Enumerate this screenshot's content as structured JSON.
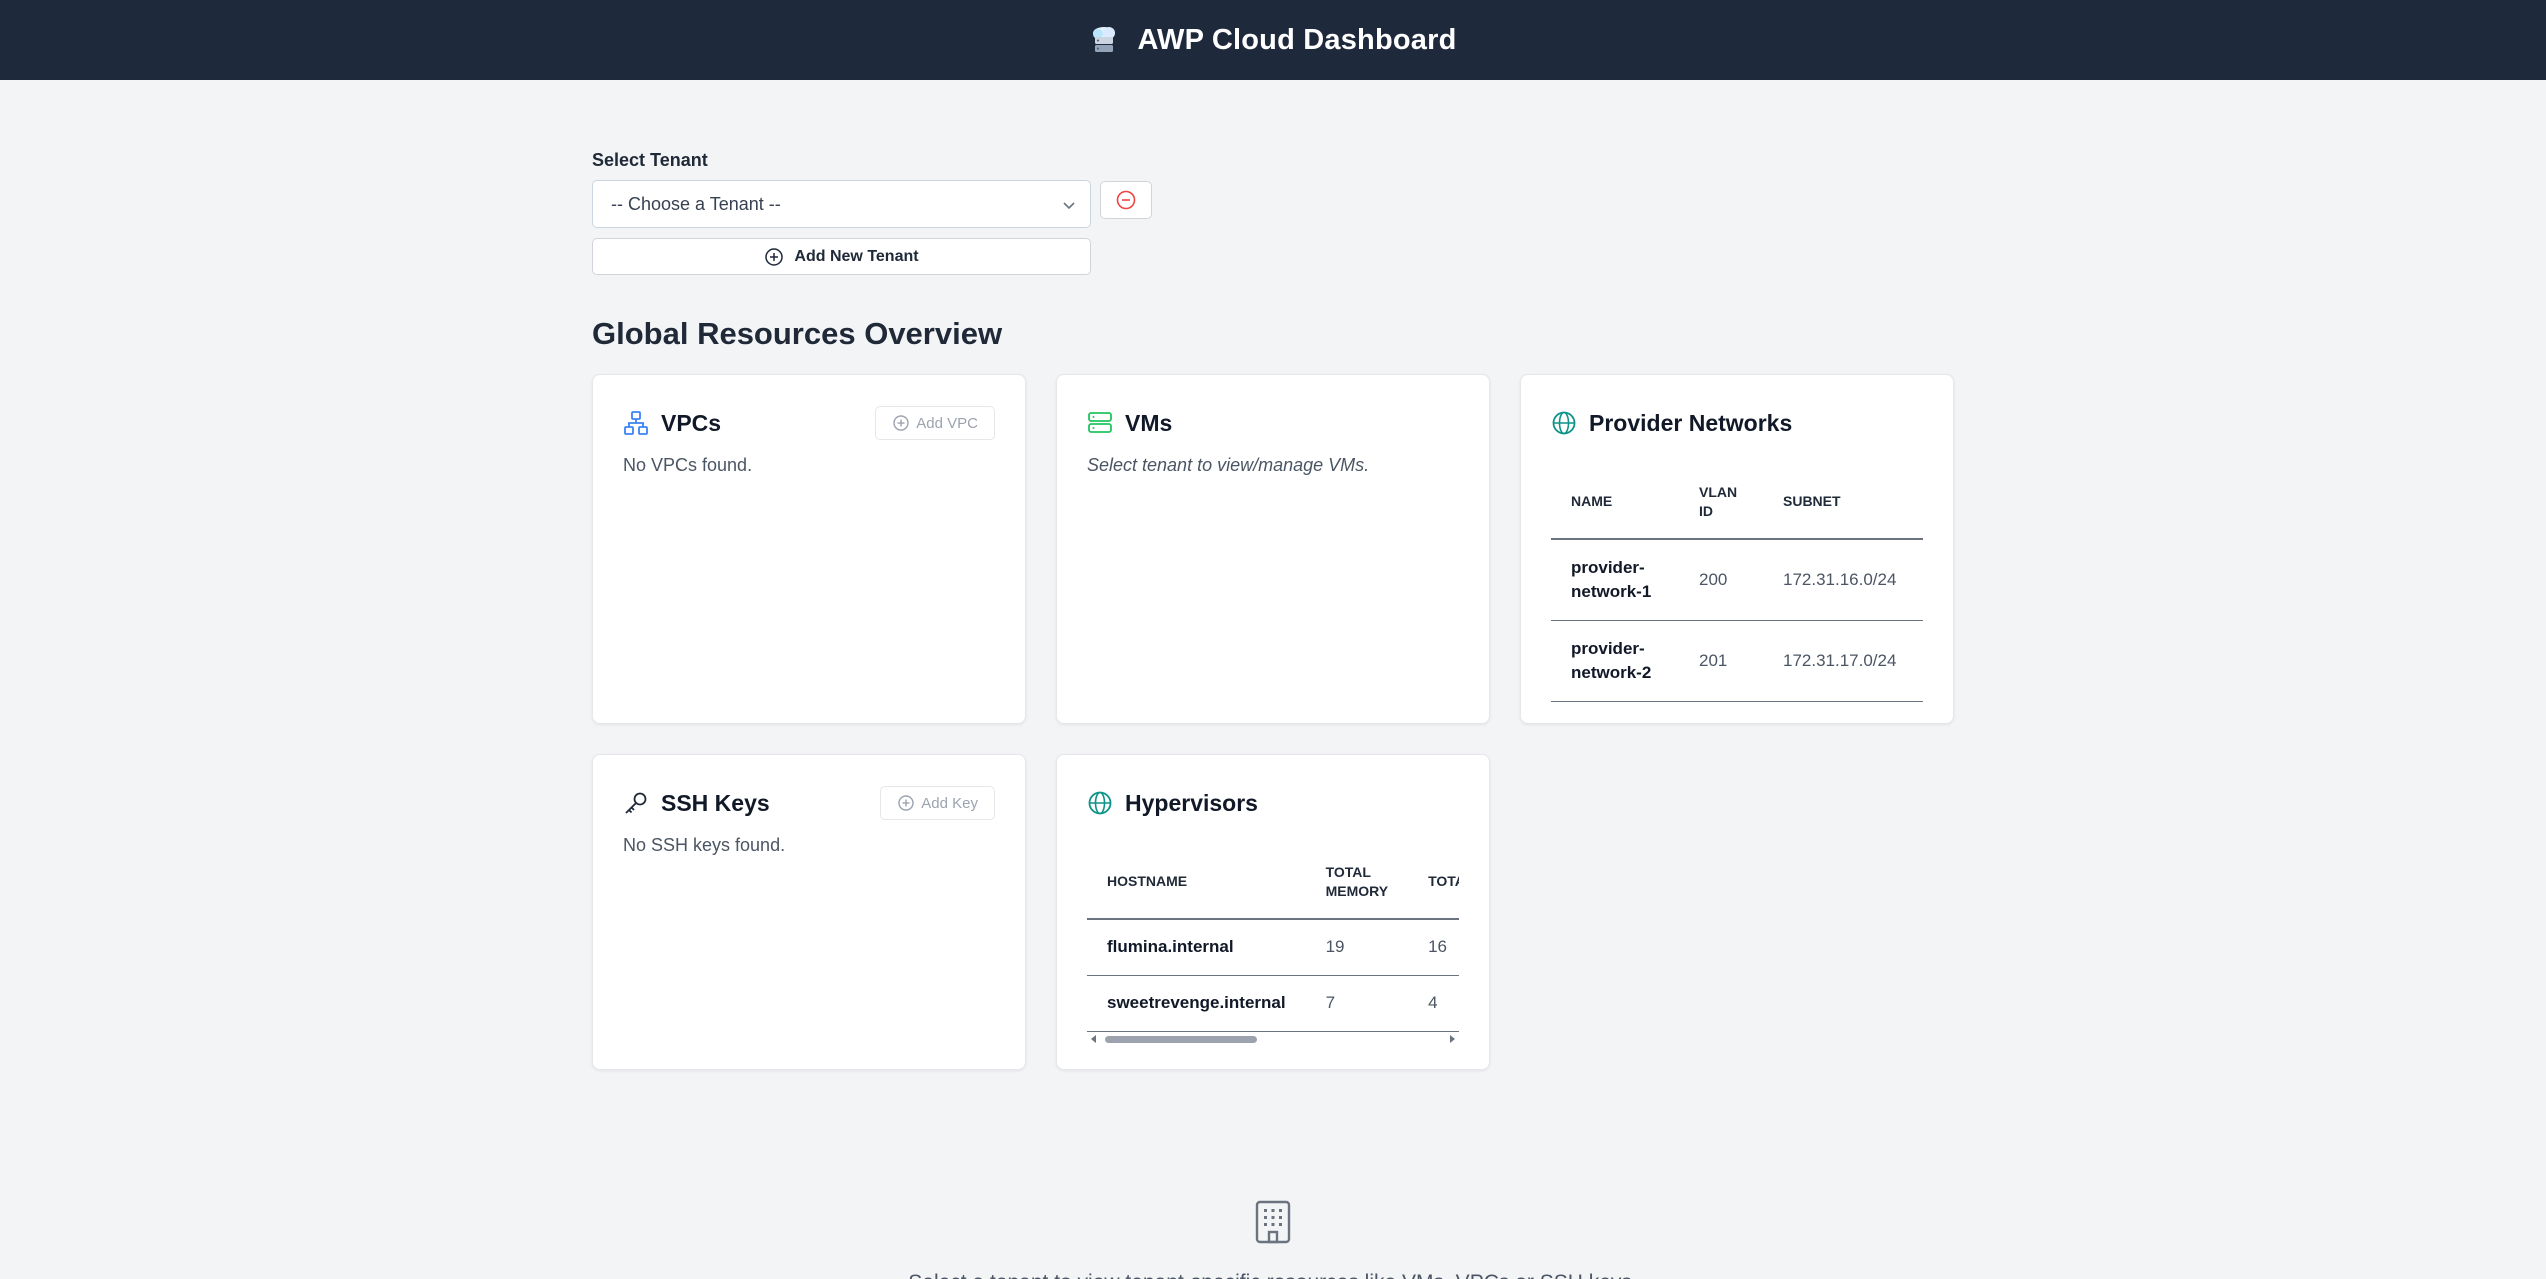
{
  "header": {
    "title": "AWP Cloud Dashboard",
    "logo_icon": "cloud-logo-icon"
  },
  "tenant": {
    "label": "Select Tenant",
    "selected": "-- Choose a Tenant --",
    "add_label": "Add New Tenant"
  },
  "overview": {
    "title": "Global Resources Overview"
  },
  "vpcs": {
    "title": "VPCs",
    "add_label": "Add VPC",
    "empty": "No VPCs found."
  },
  "vms": {
    "title": "VMs",
    "empty": "Select tenant to view/manage VMs."
  },
  "provider_networks": {
    "title": "Provider Networks",
    "columns": [
      "Name",
      "VLAN ID",
      "Subnet"
    ],
    "rows": [
      {
        "name": "provider-network-1",
        "vlan": "200",
        "subnet": "172.31.16.0/24"
      },
      {
        "name": "provider-network-2",
        "vlan": "201",
        "subnet": "172.31.17.0/24"
      }
    ]
  },
  "ssh_keys": {
    "title": "SSH Keys",
    "add_label": "Add Key",
    "empty": "No SSH keys found."
  },
  "hypervisors": {
    "title": "Hypervisors",
    "columns": [
      "Hostname",
      "Total Memory",
      "Total CPUs"
    ],
    "rows": [
      {
        "hostname": "flumina.internal",
        "memory": "19",
        "cpus": "16"
      },
      {
        "hostname": "sweetrevenge.internal",
        "memory": "7",
        "cpus": "4"
      }
    ]
  },
  "footer": {
    "message": "Select a tenant to view tenant-specific resources like VMs, VPCs or SSH keys."
  },
  "colors": {
    "topbar": "#1e293b",
    "vpc_icon": "#3b82f6",
    "vm_icon": "#22c55e",
    "network_icon": "#0d9488",
    "remove_icon": "#ef4444"
  }
}
